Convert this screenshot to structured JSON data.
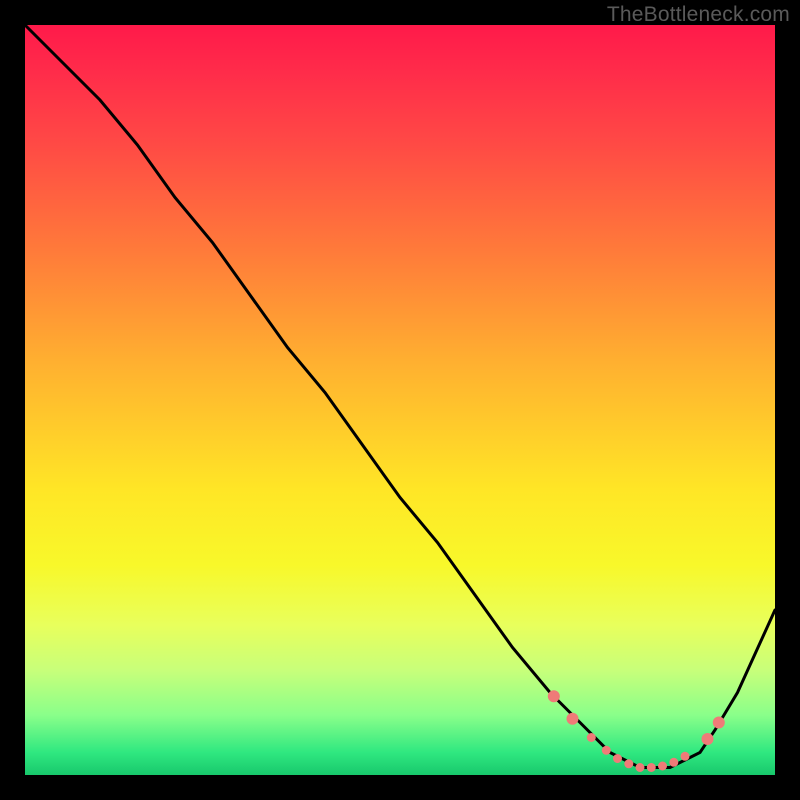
{
  "watermark": "TheBottleneck.com",
  "chart_data": {
    "type": "line",
    "title": "",
    "xlabel": "",
    "ylabel": "",
    "xlim": [
      0,
      100
    ],
    "ylim": [
      0,
      100
    ],
    "grid": false,
    "series": [
      {
        "name": "curve",
        "color": "#000000",
        "x": [
          0,
          5,
          10,
          15,
          20,
          25,
          30,
          35,
          40,
          45,
          50,
          55,
          60,
          65,
          70,
          72,
          75,
          78,
          80,
          82,
          84,
          86,
          88,
          90,
          92,
          95,
          100
        ],
        "y": [
          100,
          95,
          90,
          84,
          77,
          71,
          64,
          57,
          51,
          44,
          37,
          31,
          24,
          17,
          11,
          9,
          6,
          3,
          2,
          1,
          1,
          1,
          2,
          3,
          6,
          11,
          22
        ]
      }
    ],
    "markers": {
      "name": "optimum-range-dots",
      "color": "#ef7b78",
      "radius_primary": 6,
      "radius_secondary": 4.5,
      "points": [
        {
          "x": 70.5,
          "y": 10.5,
          "r": "primary"
        },
        {
          "x": 73.0,
          "y": 7.5,
          "r": "primary"
        },
        {
          "x": 75.5,
          "y": 5.0,
          "r": "secondary"
        },
        {
          "x": 77.5,
          "y": 3.3,
          "r": "secondary"
        },
        {
          "x": 79.0,
          "y": 2.2,
          "r": "secondary"
        },
        {
          "x": 80.5,
          "y": 1.5,
          "r": "secondary"
        },
        {
          "x": 82.0,
          "y": 1.0,
          "r": "secondary"
        },
        {
          "x": 83.5,
          "y": 1.0,
          "r": "secondary"
        },
        {
          "x": 85.0,
          "y": 1.2,
          "r": "secondary"
        },
        {
          "x": 86.5,
          "y": 1.7,
          "r": "secondary"
        },
        {
          "x": 88.0,
          "y": 2.5,
          "r": "secondary"
        },
        {
          "x": 91.0,
          "y": 4.8,
          "r": "primary"
        },
        {
          "x": 92.5,
          "y": 7.0,
          "r": "primary"
        }
      ]
    }
  }
}
